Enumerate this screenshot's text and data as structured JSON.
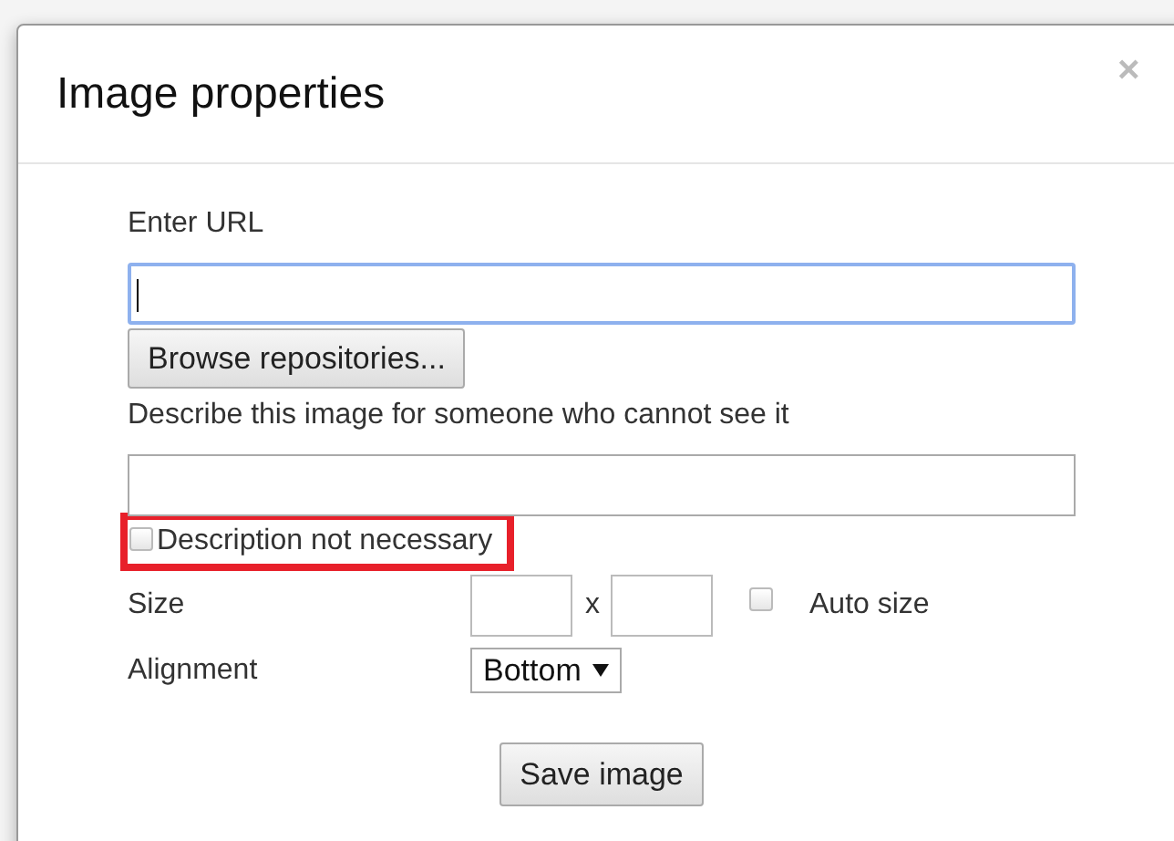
{
  "dialog": {
    "title": "Image properties",
    "close": "×"
  },
  "url": {
    "label": "Enter URL",
    "focused": true
  },
  "browse_button": "Browse repositories...",
  "description": {
    "label": "Describe this image for someone who cannot see it",
    "focused": false
  },
  "description_not_necessary": {
    "label": "Description not necessary",
    "checked": false,
    "highlighted": true
  },
  "size": {
    "label": "Size",
    "separator": "x",
    "auto_size": {
      "label": "Auto size",
      "checked": false
    }
  },
  "alignment": {
    "label": "Alignment",
    "value": "Bottom"
  },
  "save_button": "Save image"
}
